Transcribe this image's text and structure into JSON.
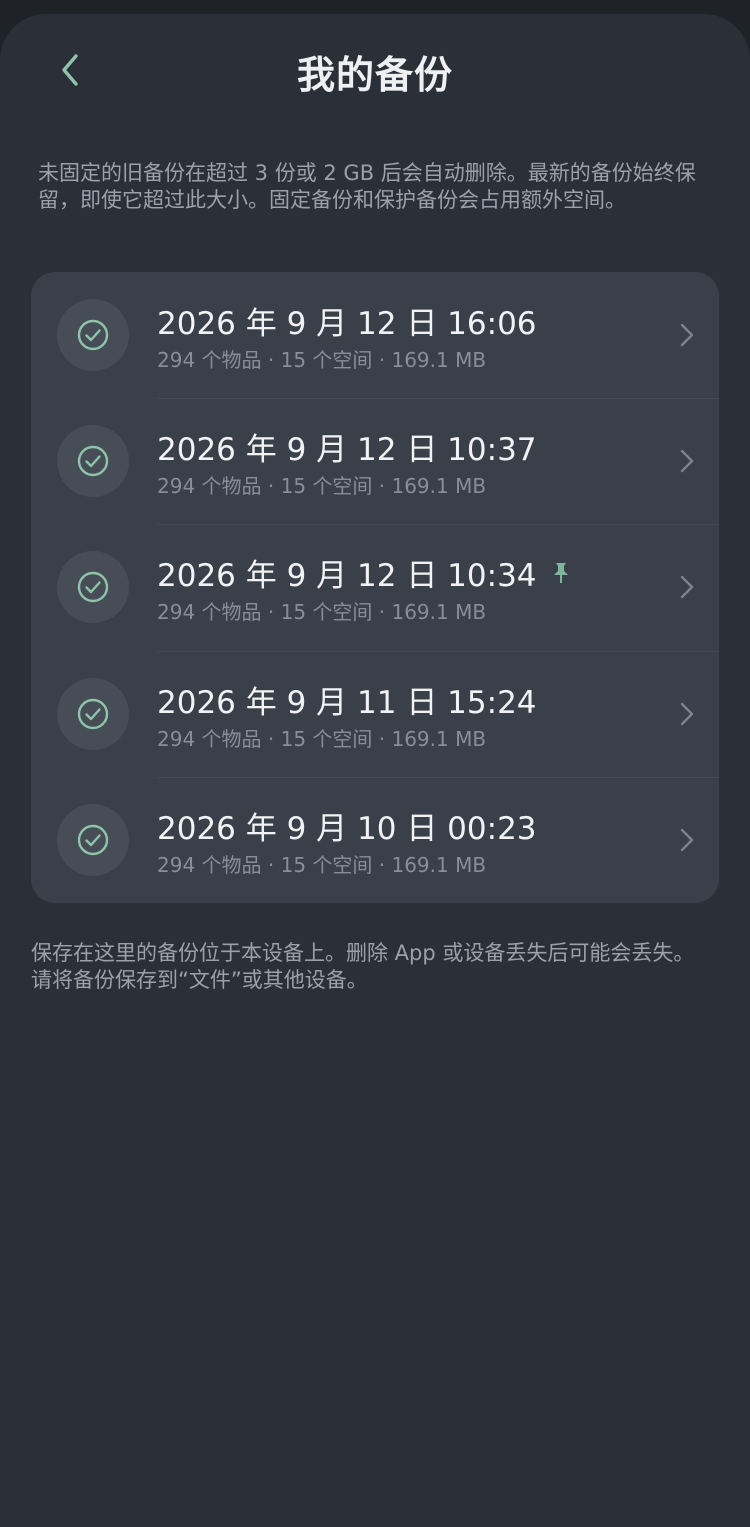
{
  "header": {
    "title": "我的备份",
    "back_icon": "chevron-left-icon"
  },
  "intro": "未固定的旧备份在超过 3 份或 2 GB 后会自动删除。最新的备份始终保留，即使它超过此大小。固定备份和保护备份会占用额外空间。",
  "backups": [
    {
      "date": "2026 年 9 月 12 日 16:06",
      "meta": "294 个物品 · 15 个空间 · 169.1 MB",
      "pinned": false
    },
    {
      "date": "2026 年 9 月 12 日 10:37",
      "meta": "294 个物品 · 15 个空间 · 169.1 MB",
      "pinned": false
    },
    {
      "date": "2026 年 9 月 12 日 10:34",
      "meta": "294 个物品 · 15 个空间 · 169.1 MB",
      "pinned": true
    },
    {
      "date": "2026 年 9 月 11 日 15:24",
      "meta": "294 个物品 · 15 个空间 · 169.1 MB",
      "pinned": false
    },
    {
      "date": "2026 年 9 月 10 日 00:23",
      "meta": "294 个物品 · 15 个空间 · 169.1 MB",
      "pinned": false
    }
  ],
  "footer": "保存在这里的备份位于本设备上。删除 App 或设备丢失后可能会丢失。请将备份保存到“文件”或其他设备。",
  "colors": {
    "background": "#2b3038",
    "card": "#3a4049",
    "accent": "#8fc3aa",
    "pin": "#7fb49e"
  }
}
